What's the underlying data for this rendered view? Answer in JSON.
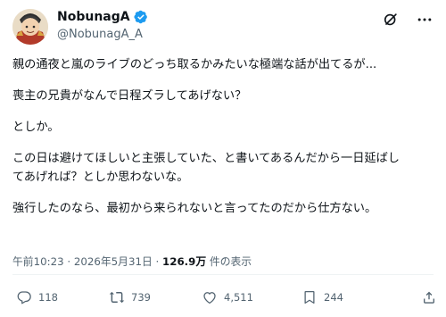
{
  "author": {
    "name": "NobunagA",
    "handle": "@NobunagA_A"
  },
  "post": {
    "paragraphs": [
      "親の通夜と嵐のライブのどっち取るかみたいな極端な話が出てるが...",
      "喪主の兄貴がなんで日程ズラしてあげない？",
      "としか。",
      "この日は避けてほしいと主張していた、と書いてあるんだから一日延ばし\nてあげれば？としか思わないな。",
      "強行したのなら、最初から来られないと言ってたのだから仕方ない。"
    ]
  },
  "meta": {
    "time": "午前10:23",
    "separator": "·",
    "date": "2026年5月31日",
    "views": "126.9万",
    "views_label": "件の表示"
  },
  "actions": {
    "replies": "118",
    "reposts": "739",
    "likes": "4,511",
    "bookmarks": "244"
  },
  "icons": [
    "verified-badge-icon",
    "grok-icon",
    "more-icon",
    "reply-icon",
    "repost-icon",
    "like-icon",
    "views-icon",
    "bookmark-icon",
    "share-icon"
  ],
  "colors": {
    "text": "#0f1419",
    "secondary": "#536471",
    "verified": "#1d9bf0",
    "divider": "#eff3f4"
  }
}
